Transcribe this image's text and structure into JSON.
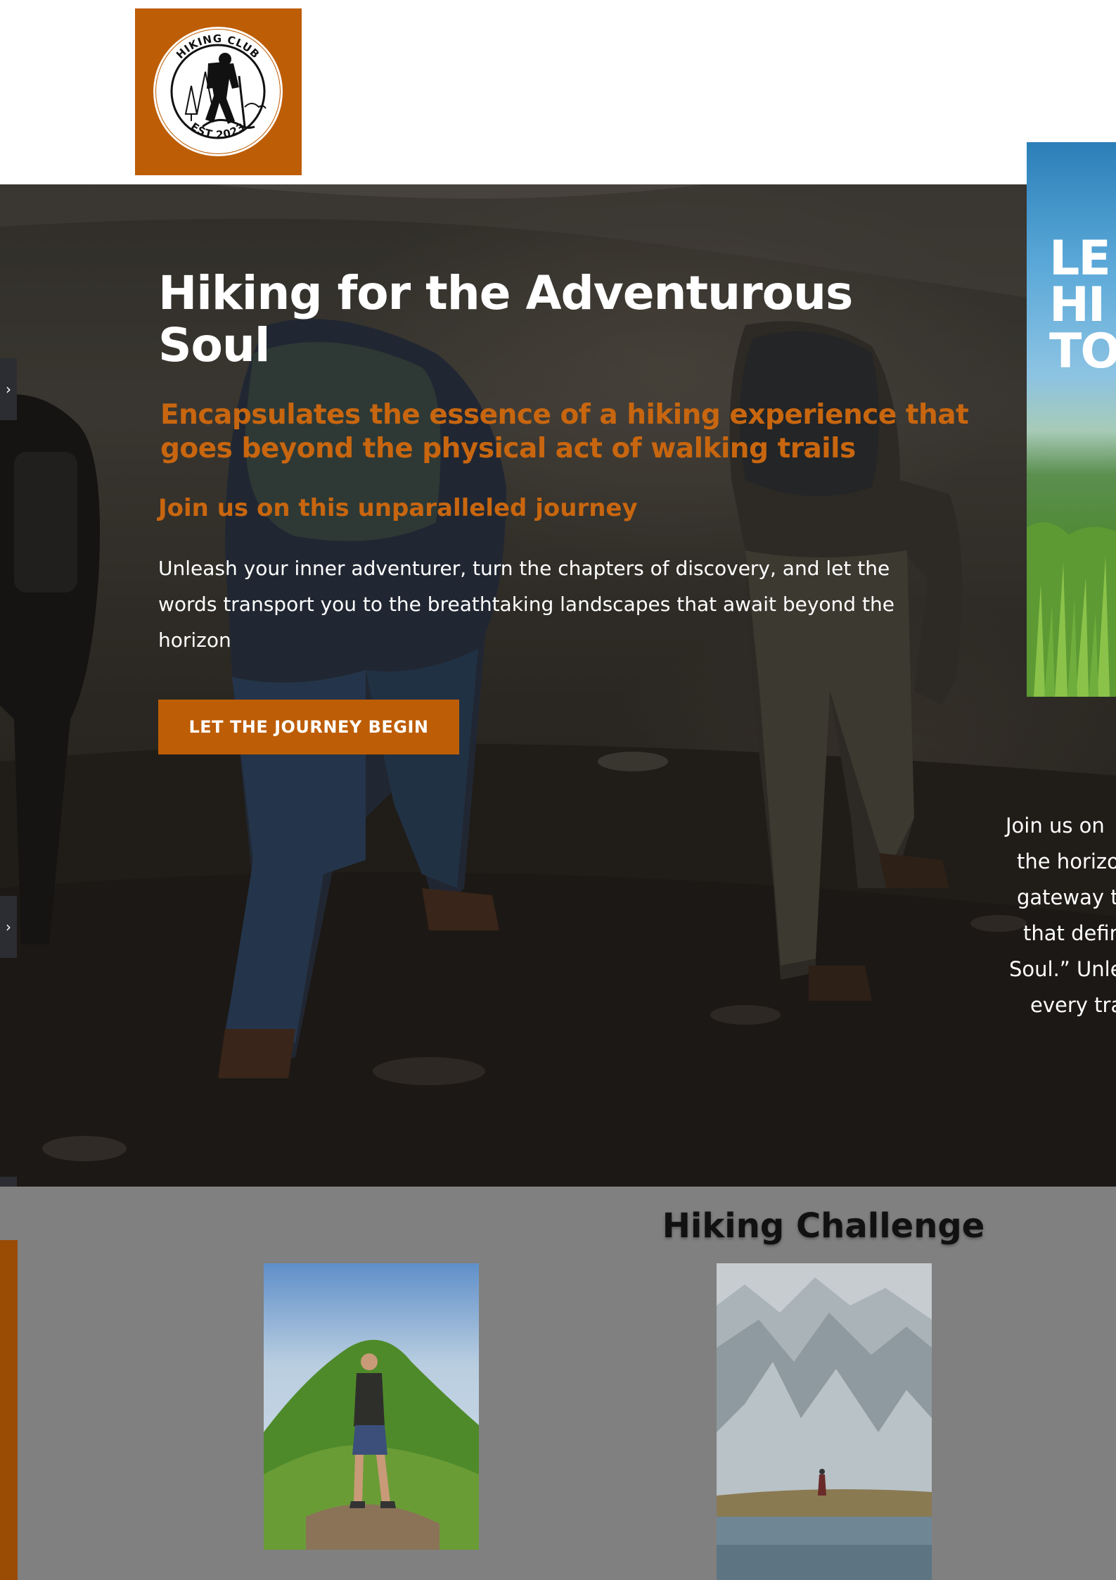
{
  "header": {
    "logo": {
      "text_top": "HIKING CLUB",
      "text_bottom": "EST 2023",
      "icon": "hiker-logo-icon"
    }
  },
  "hero": {
    "title": "Hiking for the Adventurous Soul",
    "subtitle": "Encapsulates the essence of a hiking experience that goes beyond the physical act of walking trails",
    "tagline": "Join us on this unparalleled journey",
    "body": "Unleash your inner adventurer, turn the chapters of discovery, and let the words transport you to the breathtaking landscapes that await beyond the horizon",
    "cta_label": "LET THE JOURNEY BEGIN"
  },
  "side_tabs": {
    "icon": "chevron-right-icon",
    "glyph": "›"
  },
  "poster": {
    "lines": [
      "LE",
      "HI",
      "TO"
    ]
  },
  "side_text": {
    "lines": [
      "Join us on",
      "the horizo",
      "gateway to",
      "that defin",
      "Soul.” Unle",
      "every tra"
    ]
  },
  "challenge": {
    "title": "Hiking Challenge"
  },
  "colors": {
    "accent": "#bd5d05",
    "accent_text": "#c8660f",
    "section_bg": "#808080"
  }
}
